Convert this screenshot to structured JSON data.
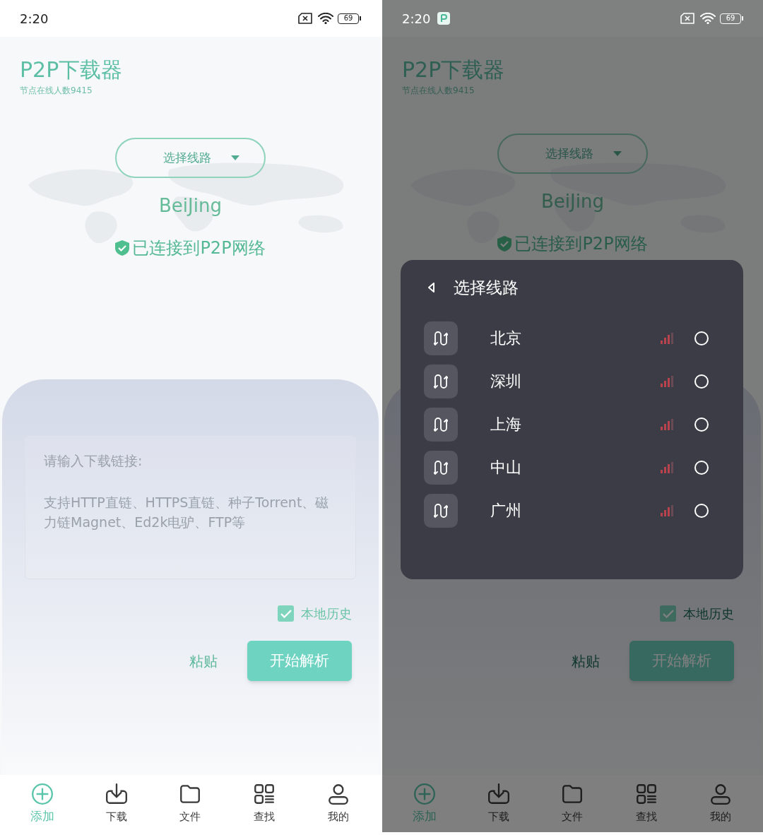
{
  "screens": [
    {
      "status_bar": {
        "time": "2:20",
        "battery": "69",
        "app_notification": false
      },
      "header": {
        "title": "P2P下载器",
        "subtitle": "节点在线人数9415"
      },
      "route_button": "选择线路",
      "location": "BeiJing",
      "connection_status": "已连接到P2P网络",
      "link_input": {
        "placeholder": "请输入下载链接:",
        "hint": " 支持HTTP直链、HTTPS直链、种子Torrent、磁力链Magnet、Ed2k电驴、FTP等"
      },
      "history": {
        "label": "本地历史",
        "checked": true
      },
      "paste_button": "粘贴",
      "parse_button": "开始解析",
      "nav": [
        {
          "kind": "add",
          "label": "添加",
          "selected": true
        },
        {
          "kind": "download",
          "label": "下载",
          "selected": false
        },
        {
          "kind": "files",
          "label": "文件",
          "selected": false
        },
        {
          "kind": "search",
          "label": "查找",
          "selected": false
        },
        {
          "kind": "profile",
          "label": "我的",
          "selected": false
        }
      ]
    },
    {
      "status_bar": {
        "time": "2:20",
        "battery": "69",
        "app_notification": true
      },
      "header": {
        "title": "P2P下载器",
        "subtitle": "节点在线人数9415"
      },
      "route_button": "选择线路",
      "location": "BeiJing",
      "connection_status": "已连接到P2P网络",
      "history": {
        "label": "本地历史",
        "checked": true
      },
      "paste_button": "粘贴",
      "parse_button": "开始解析",
      "nav": [
        {
          "kind": "add",
          "label": "添加",
          "selected": true
        },
        {
          "kind": "download",
          "label": "下载",
          "selected": false
        },
        {
          "kind": "files",
          "label": "文件",
          "selected": false
        },
        {
          "kind": "search",
          "label": "查找",
          "selected": false
        },
        {
          "kind": "profile",
          "label": "我的",
          "selected": false
        }
      ],
      "dialog": {
        "title": "选择线路",
        "routes": [
          {
            "name": "北京",
            "selected": false
          },
          {
            "name": "深圳",
            "selected": false
          },
          {
            "name": "上海",
            "selected": false
          },
          {
            "name": "中山",
            "selected": false
          },
          {
            "name": "广州",
            "selected": false
          }
        ]
      }
    }
  ]
}
